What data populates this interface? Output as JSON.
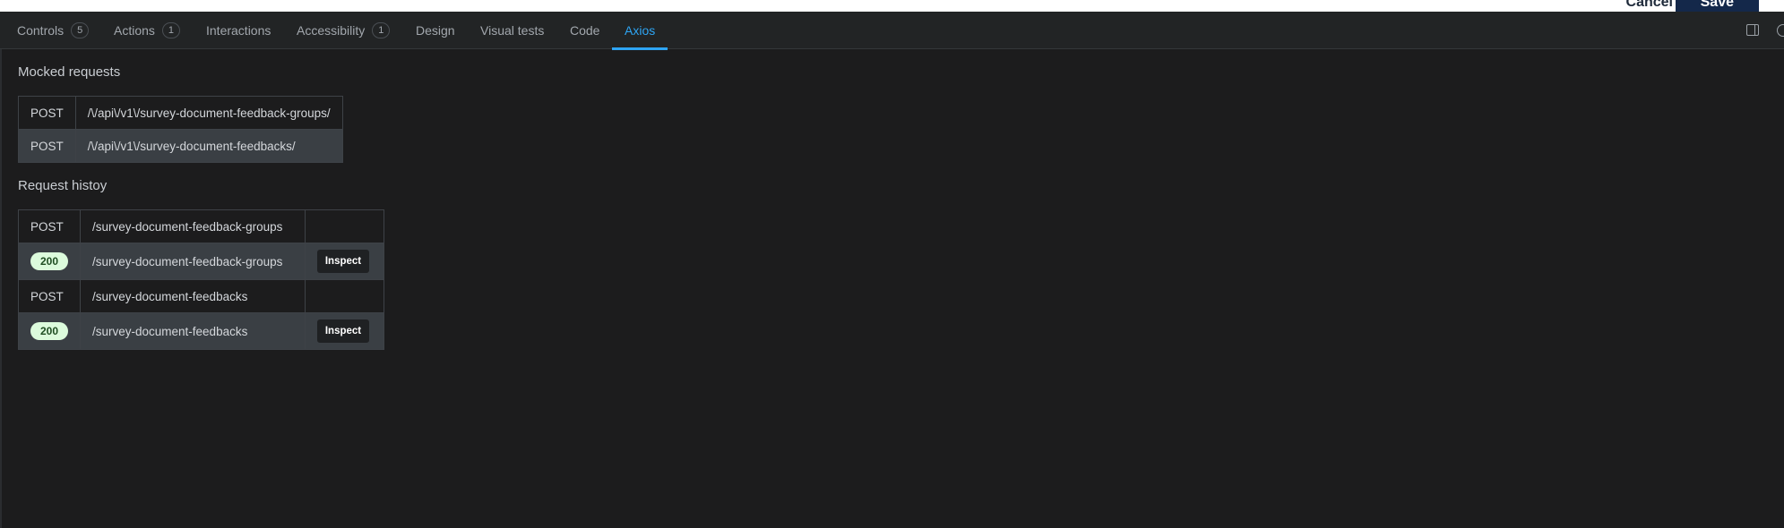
{
  "header": {
    "cancel_label": "Cancel",
    "save_label": "Save"
  },
  "tabs": [
    {
      "label": "Controls",
      "count": "5"
    },
    {
      "label": "Actions",
      "count": "1"
    },
    {
      "label": "Interactions"
    },
    {
      "label": "Accessibility",
      "count": "1"
    },
    {
      "label": "Design"
    },
    {
      "label": "Visual tests"
    },
    {
      "label": "Code"
    },
    {
      "label": "Axios",
      "active": true
    }
  ],
  "mocked": {
    "title": "Mocked requests",
    "rows": [
      {
        "method": "POST",
        "url": "/\\/api\\/v1\\/survey-document-feedback-groups/"
      },
      {
        "method": "POST",
        "url": "/\\/api\\/v1\\/survey-document-feedbacks/"
      }
    ]
  },
  "history": {
    "title": "Request histoy",
    "rows": [
      {
        "method": "POST",
        "path": "/survey-document-feedback-groups"
      },
      {
        "status": "200",
        "path": "/survey-document-feedback-groups",
        "action": "Inspect"
      },
      {
        "method": "POST",
        "path": "/survey-document-feedbacks"
      },
      {
        "status": "200",
        "path": "/survey-document-feedbacks",
        "action": "Inspect"
      }
    ]
  },
  "colors": {
    "accent": "#2ea5f4",
    "background": "#1c1c1d",
    "status_ok_bg": "#dcfbdc"
  },
  "icons": {
    "panel_toggle": "sidebar-panel-icon",
    "edge": "settings-icon"
  }
}
